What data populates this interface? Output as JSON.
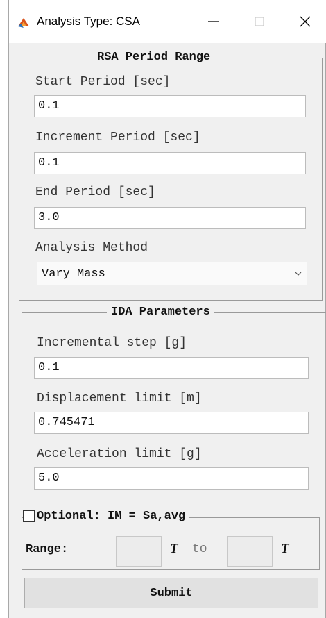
{
  "window": {
    "title": "Analysis Type: CSA"
  },
  "rsa": {
    "title": "RSA Period Range",
    "start_label": "Start Period [sec]",
    "start_value": "0.1",
    "increment_label": "Increment Period [sec]",
    "increment_value": "0.1",
    "end_label": "End Period [sec]",
    "end_value": "3.0",
    "method_label": "Analysis Method",
    "method_value": "Vary Mass"
  },
  "ida": {
    "title": "IDA Parameters",
    "step_label": "Incremental step [g]",
    "step_value": "0.1",
    "disp_label": "Displacement limit [m]",
    "disp_value": "0.745471",
    "accel_label": "Acceleration limit [g]",
    "accel_value": "5.0"
  },
  "optional": {
    "title": "Optional: IM = Sa,avg",
    "checked": false,
    "range_label": "Range:",
    "t_symbol": "T",
    "to_label": "to",
    "range_start": "",
    "range_end": ""
  },
  "submit_label": "Submit",
  "colors": {
    "frame": "#f0f0f0",
    "border": "#9a9a9a",
    "field": "#ffffff",
    "button": "#e1e1e1"
  },
  "icons": {
    "app": "matlab-logo-icon",
    "minimize": "minimize-icon",
    "maximize": "maximize-icon",
    "close": "close-icon"
  }
}
